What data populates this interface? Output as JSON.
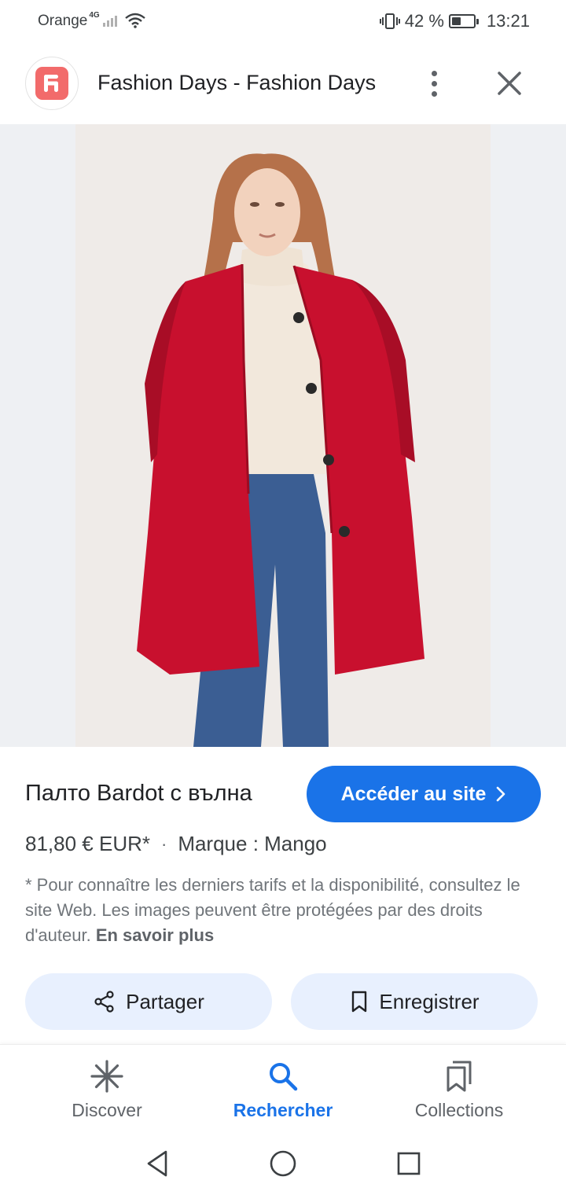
{
  "status_bar": {
    "carrier": "Orange",
    "network_type": "4G",
    "battery_percent": "42 %",
    "battery_level": 0.42,
    "time": "13:21"
  },
  "header": {
    "site_title": "Fashion Days - Fashion Days",
    "logo_color": "#f26b6b"
  },
  "product": {
    "title": "Палто Bardot с вълна",
    "price": "81,80 € EUR*",
    "separator": "·",
    "brand": "Marque : Mango",
    "visit_button_label": "Accéder au site",
    "disclaimer_text": "* Pour connaître les derniers tarifs et la disponibilité, consultez le site Web. Les images peuvent être protégées par des droits d'auteur. ",
    "learn_more_label": "En savoir plus",
    "coat_color": "#c8102e"
  },
  "actions": {
    "share_label": "Partager",
    "save_label": "Enregistrer"
  },
  "bottom_nav": {
    "items": [
      {
        "label": "Discover",
        "icon": "asterisk-icon",
        "active": false
      },
      {
        "label": "Rechercher",
        "icon": "search-icon",
        "active": true
      },
      {
        "label": "Collections",
        "icon": "collections-icon",
        "active": false
      }
    ]
  },
  "colors": {
    "accent": "#1a73e8",
    "chip_bg": "#e8f0fe"
  }
}
